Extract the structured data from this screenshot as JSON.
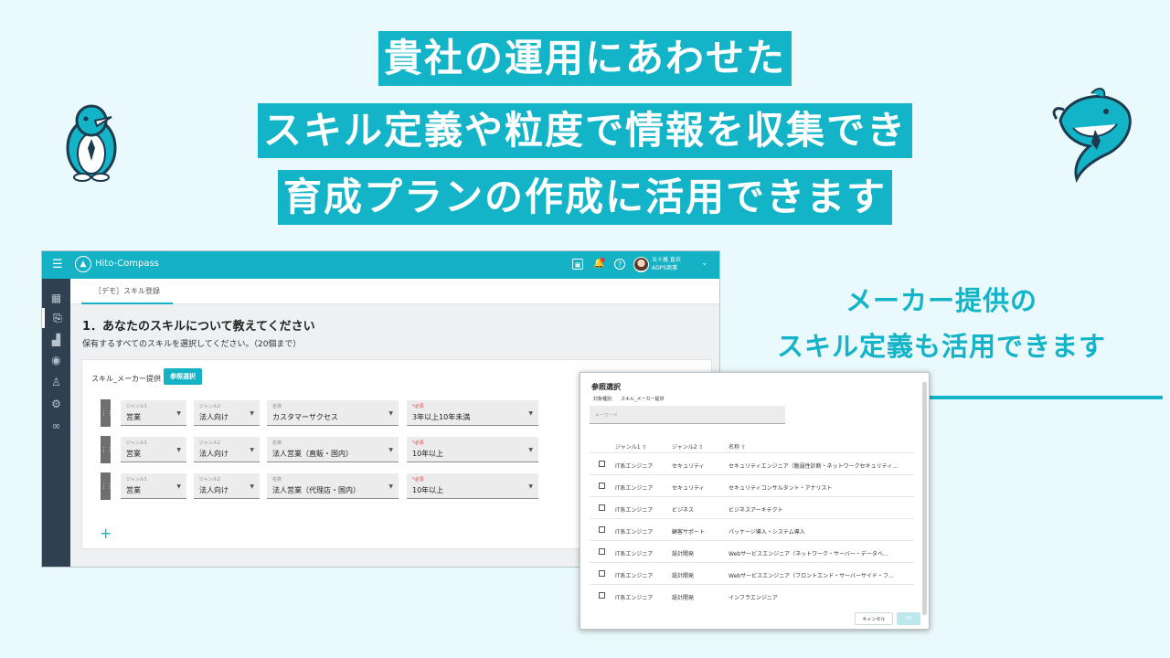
{
  "headline": {
    "line1": "貴社の運用にあわせた",
    "line2": "スキル定義や粒度で情報を収集でき",
    "line3": "育成プランの作成に活用できます"
  },
  "side_note": {
    "line1": "メーカー提供の",
    "line2": "スキル定義も活用できます"
  },
  "colors": {
    "accent": "#14b4c8",
    "sidebar": "#2f4050",
    "background": "#eaf9fb"
  },
  "app": {
    "brand": "Hito-Compass",
    "menu_icon": "☰",
    "user": {
      "name": "五十嵐 直衣",
      "company": "ADPS商事"
    },
    "sidebar_icons": [
      "dashboard-icon",
      "document-import-icon",
      "chart-icon",
      "search-person-icon",
      "person-icon",
      "settings-icon",
      "link-icon"
    ],
    "tab_label": "［デモ］スキル登録",
    "question_title": "1．あなたのスキルについて教えてください",
    "question_sub": "保有するすべてのスキルを選択してください。（20個まで）",
    "source_label": "スキル_メーカー提供",
    "ref_button": "参照選択",
    "field_labels": {
      "genre1": "ジャンル1",
      "genre2": "ジャンル2",
      "name": "名称",
      "required": "*必須"
    },
    "rows": [
      {
        "genre1": "営業",
        "genre2": "法人向け",
        "name": "カスタマーサクセス",
        "level": "3年以上10年未満"
      },
      {
        "genre1": "営業",
        "genre2": "法人向け",
        "name": "法人営業（直販・国内）",
        "level": "10年以上"
      },
      {
        "genre1": "営業",
        "genre2": "法人向け",
        "name": "法人営業（代理店・国内）",
        "level": "10年以上"
      }
    ],
    "add_button": "+"
  },
  "dialog": {
    "title": "参照選択",
    "filter_key": "対象種別",
    "filter_value": "スキル_メーカー提供",
    "keyword_placeholder": "キーワード",
    "columns": [
      "ジャンル1 ⇧",
      "ジャンル2 ⇧",
      "名称 ⇧"
    ],
    "rows": [
      {
        "genre1": "IT系エンジニア",
        "genre2": "セキュリティ",
        "name": "セキュリティエンジニア（脆弱性診断・ネットワークセキュリティ…"
      },
      {
        "genre1": "IT系エンジニア",
        "genre2": "セキュリティ",
        "name": "セキュリティコンサルタント・アナリスト"
      },
      {
        "genre1": "IT系エンジニア",
        "genre2": "ビジネス",
        "name": "ビジネスアーキテクト"
      },
      {
        "genre1": "IT系エンジニア",
        "genre2": "顧客サポート",
        "name": "パッケージ導入・システム導入"
      },
      {
        "genre1": "IT系エンジニア",
        "genre2": "設計開発",
        "name": "Webサービスエンジニア（ネットワーク・サーバー・データベ…"
      },
      {
        "genre1": "IT系エンジニア",
        "genre2": "設計開発",
        "name": "Webサービスエンジニア（フロントエンド・サーバーサイド・フ…"
      },
      {
        "genre1": "IT系エンジニア",
        "genre2": "設計開発",
        "name": "インフラエンジニア"
      }
    ],
    "cancel_label": "キャンセル",
    "ok_label": "OK"
  }
}
